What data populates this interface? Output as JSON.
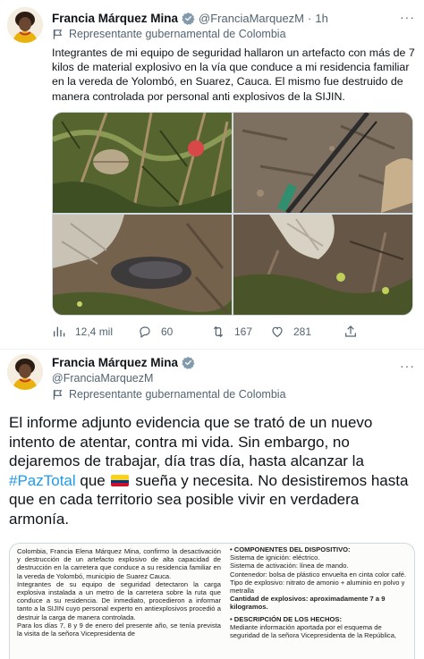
{
  "tweet1": {
    "author_name": "Francia Márquez Mina",
    "handle": "@FranciaMarquezM",
    "separator": "·",
    "time": "1h",
    "label": "Representante gubernamental de Colombia",
    "text": "Integrantes de mi equipo de seguridad hallaron un artefacto con más de 7 kilos de material explosivo en la vía que conduce a mi residencia familiar en la vereda de Yolombó, en Suarez, Cauca. El mismo fue destruido de manera controlada por personal anti explosivos de la SIJIN.",
    "more": "···",
    "metrics": {
      "views": "12,4 mil",
      "replies": "60",
      "retweets": "167",
      "likes": "281"
    }
  },
  "tweet2": {
    "author_name": "Francia Márquez Mina",
    "handle": "@FranciaMarquezM",
    "label": "Representante gubernamental de Colombia",
    "more": "···",
    "text_part1": "El informe adjunto evidencia que se trató de un nuevo intento de atentar, contra mi vida. Sin embargo, no dejaremos de trabajar, día tras día, hasta alcanzar la ",
    "hashtag": "#PazTotal",
    "text_part2": " que ",
    "text_part3": " sueña y necesita. No desistiremos hasta que en cada territorio sea posible vivir en verdadera armonía."
  },
  "document": {
    "left_p1": "Colombia, Francia Elena Márquez Mina, confirmo la desactivación y destrucción de un artefacto explosivo de alta capacidad de destrucción en la carretera que conduce a su residencia familiar en la vereda de Yolombó, municipio de Suarez Cauca.",
    "left_p2": "Integrantes de su equipo de seguridad detectaron la carga explosiva instalada a un metro de la carretera sobre la ruta que conduce a su residencia. De inmediato, procedieron a informar tanto a la SIJIN cuyo personal experto en antiexplosivos procedió a destruir la carga de manera controlada.",
    "left_p3": "Para los días 7, 8 y 9 de enero del presente año, se tenía prevista la visita de la señora Vicepresidenta de",
    "right_h1": "• COMPONENTES DEL DISPOSITIVO:",
    "right_l1": "Sistema de ignición: eléctrico.",
    "right_l2": "Sistema de activación: línea de mando.",
    "right_l3": "Contenedor: bolsa de plástico envuelta en cinta color café.",
    "right_l4": "Tipo de explosivo: nitrato de amonio + aluminio en polvo y metralla",
    "right_l5": "Cantidad de explosivos: aproximadamente 7 a 9 kilogramos.",
    "right_h2": "• DESCRIPCIÓN DE LOS HECHOS:",
    "right_l6": "Mediante información aportada por el esquema de seguridad de la señora Vicepresidenta de la República,"
  },
  "colors": {
    "accent": "#1d9bf0",
    "text": "#0f1419",
    "muted": "#536471",
    "flag_yellow": "#fcd116",
    "flag_blue": "#003893",
    "flag_red": "#ce1126"
  }
}
